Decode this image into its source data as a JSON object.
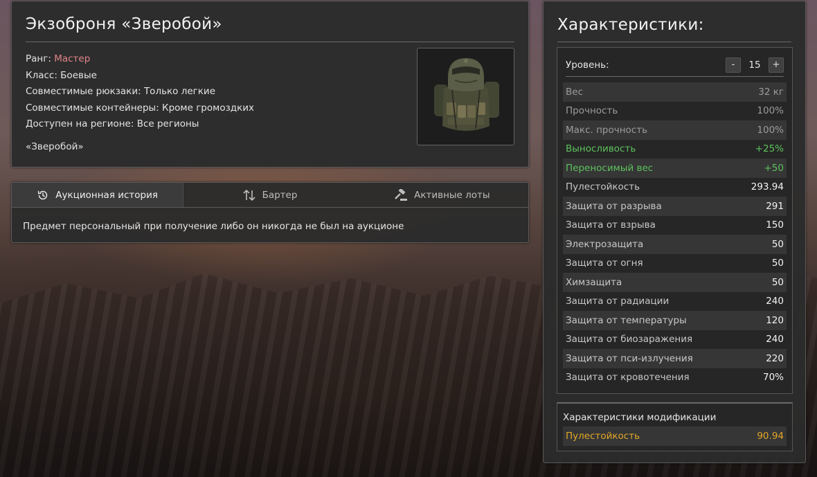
{
  "item": {
    "title": "Экзоброня «Зверобой»",
    "rank_label": "Ранг:",
    "rank_value": "Мастер",
    "class_line": "Класс: Боевые",
    "backpacks_line": "Совместимые рюкзаки: Только легкие",
    "containers_line": "Совместимые контейнеры: Кроме громоздких",
    "region_line": "Доступен на регионе: Все регионы",
    "quote": "«Зверобой»",
    "image_icon": "exoskeleton-armor-icon"
  },
  "tabs": [
    {
      "label": "Аукционная история",
      "icon": "history-icon",
      "active": true
    },
    {
      "label": "Бартер",
      "icon": "swap-arrows-icon",
      "active": false
    },
    {
      "label": "Активные лоты",
      "icon": "gavel-icon",
      "active": false
    }
  ],
  "history_note": "Предмет персональный при получение либо он никогда не был на аукционе",
  "stats": {
    "title": "Характеристики:",
    "level_label": "Уровень:",
    "level_minus": "-",
    "level_value": "15",
    "level_plus": "+",
    "rows": [
      {
        "label": "Вес",
        "value": "32 кг"
      },
      {
        "label": "Прочность",
        "value": "100%"
      },
      {
        "label": "Макс. прочность",
        "value": "100%"
      },
      {
        "label": "Выносливость",
        "value": "+25%"
      },
      {
        "label": "Переносимый вес",
        "value": "+50"
      },
      {
        "label": "Пулестойкость",
        "value": "293.94"
      },
      {
        "label": "Защита от разрыва",
        "value": "291"
      },
      {
        "label": "Защита от взрыва",
        "value": "150"
      },
      {
        "label": "Электрозащита",
        "value": "50"
      },
      {
        "label": "Защита от огня",
        "value": "50"
      },
      {
        "label": "Химзащита",
        "value": "50"
      },
      {
        "label": "Защита от радиации",
        "value": "240"
      },
      {
        "label": "Защита от температуры",
        "value": "120"
      },
      {
        "label": "Защита от биозаражения",
        "value": "240"
      },
      {
        "label": "Защита от пси-излучения",
        "value": "220"
      },
      {
        "label": "Защита от кровотечения",
        "value": "70%"
      }
    ]
  },
  "mods": {
    "title": "Характеристики модификации",
    "row_label": "Пулестойкость",
    "row_value": "90.94"
  },
  "colors": {
    "rank": "#e0858a",
    "positive": "#5dc15d",
    "modification": "#e3a827"
  }
}
